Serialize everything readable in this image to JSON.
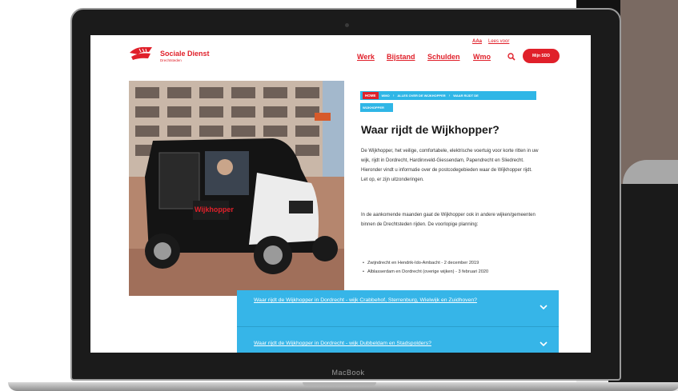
{
  "device": {
    "brand_label": "MacBook"
  },
  "header": {
    "logo_name": "Sociale Dienst",
    "logo_sub": "Drechtsteden",
    "util_aa": "AAa",
    "util_lees": "Lees voor",
    "nav": [
      "Werk",
      "Bijstand",
      "Schulden",
      "Wmo"
    ],
    "search_icon": "search-icon",
    "mijn_button": "Mijn SDD"
  },
  "breadcrumb": {
    "home": "HOME",
    "items": [
      "WMO",
      "ALLES OVER DE WIJKHOPPER",
      "WAAR RIJDT DE"
    ],
    "continued": "WIJKHOPPER"
  },
  "page": {
    "title": "Waar rijdt de Wijkhopper?",
    "para1": "De Wijkhopper, het veilige, comfortabele, elektrische voertuig voor korte ritten in uw wijk, rijdt in Dordrecht, Hardinxveld-Giessendam, Papendrecht en Sliedrecht. Hieronder vindt u informatie over de postcodegebieden waar de Wijkhopper rijdt. Let op, er zijn uitzonderingen.",
    "para2": "In de aankomende maanden gaat de Wijkhopper ook in andere wijken/gemeenten binnen de Drechtsteden rijden. De voorlopige planning:",
    "bullets": [
      "Zwijndrecht en Hendrik-Ido-Ambacht - 2 december 2019",
      "Alblasserdam en Dordrecht (overige wijken) - 3 februari 2020"
    ]
  },
  "accordion": [
    {
      "label": "Waar rijdt de Wijkhopper in Dordrecht - wijk Crabbehof, Sterrenburg, Wielwijk en Zuidhoven?"
    },
    {
      "label": "Waar rijdt de Wijkhopper in Dordrecht - wijk Dubbeldam en Stadspolders?"
    }
  ],
  "photo": {
    "vehicle_sign": "Wijkhopper"
  },
  "colors": {
    "brand_red": "#e0202a",
    "accent_blue": "#36b5e8"
  }
}
